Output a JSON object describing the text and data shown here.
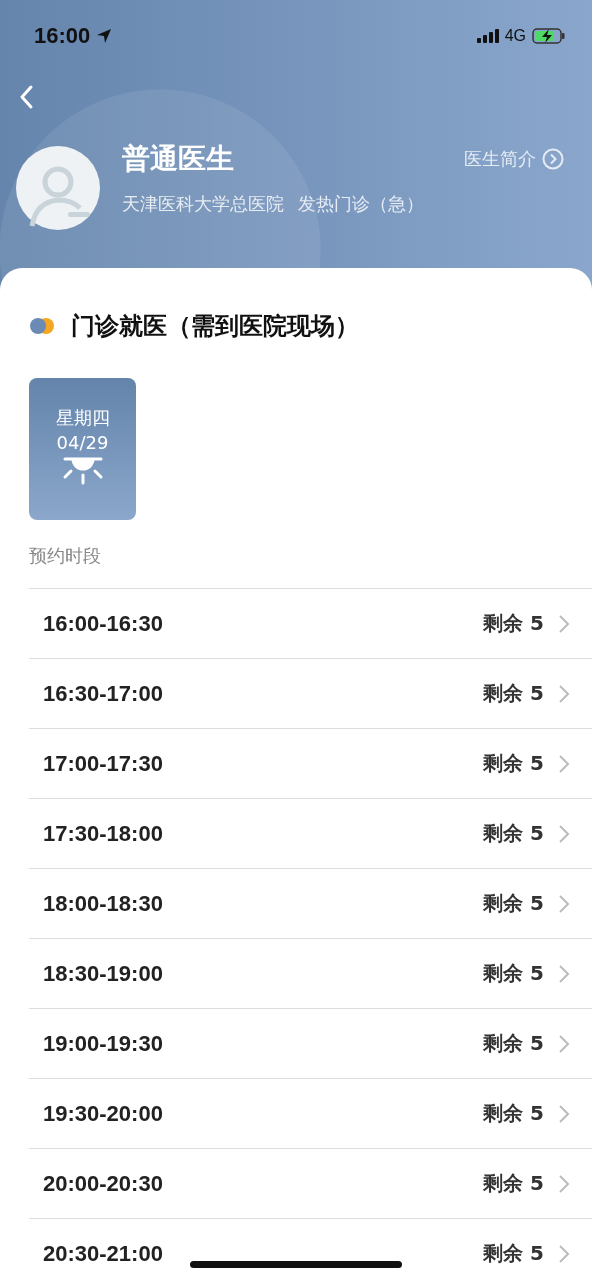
{
  "status_bar": {
    "time": "16:00",
    "network": "4G"
  },
  "doctor": {
    "name": "普通医生",
    "hospital": "天津医科大学总医院",
    "department": "发热门诊（急）",
    "profile_link": "医生简介"
  },
  "section": {
    "title": "门诊就医（需到医院现场）"
  },
  "dates": [
    {
      "weekday": "星期四",
      "date": "04/29",
      "selected": true
    }
  ],
  "slots_label": "预约时段",
  "slots": [
    {
      "time": "16:00-16:30",
      "remaining": "剩余 5"
    },
    {
      "time": "16:30-17:00",
      "remaining": "剩余 5"
    },
    {
      "time": "17:00-17:30",
      "remaining": "剩余 5"
    },
    {
      "time": "17:30-18:00",
      "remaining": "剩余 5"
    },
    {
      "time": "18:00-18:30",
      "remaining": "剩余 5"
    },
    {
      "time": "18:30-19:00",
      "remaining": "剩余 5"
    },
    {
      "time": "19:00-19:30",
      "remaining": "剩余 5"
    },
    {
      "time": "19:30-20:00",
      "remaining": "剩余 5"
    },
    {
      "time": "20:00-20:30",
      "remaining": "剩余 5"
    },
    {
      "time": "20:30-21:00",
      "remaining": "剩余 5"
    }
  ]
}
